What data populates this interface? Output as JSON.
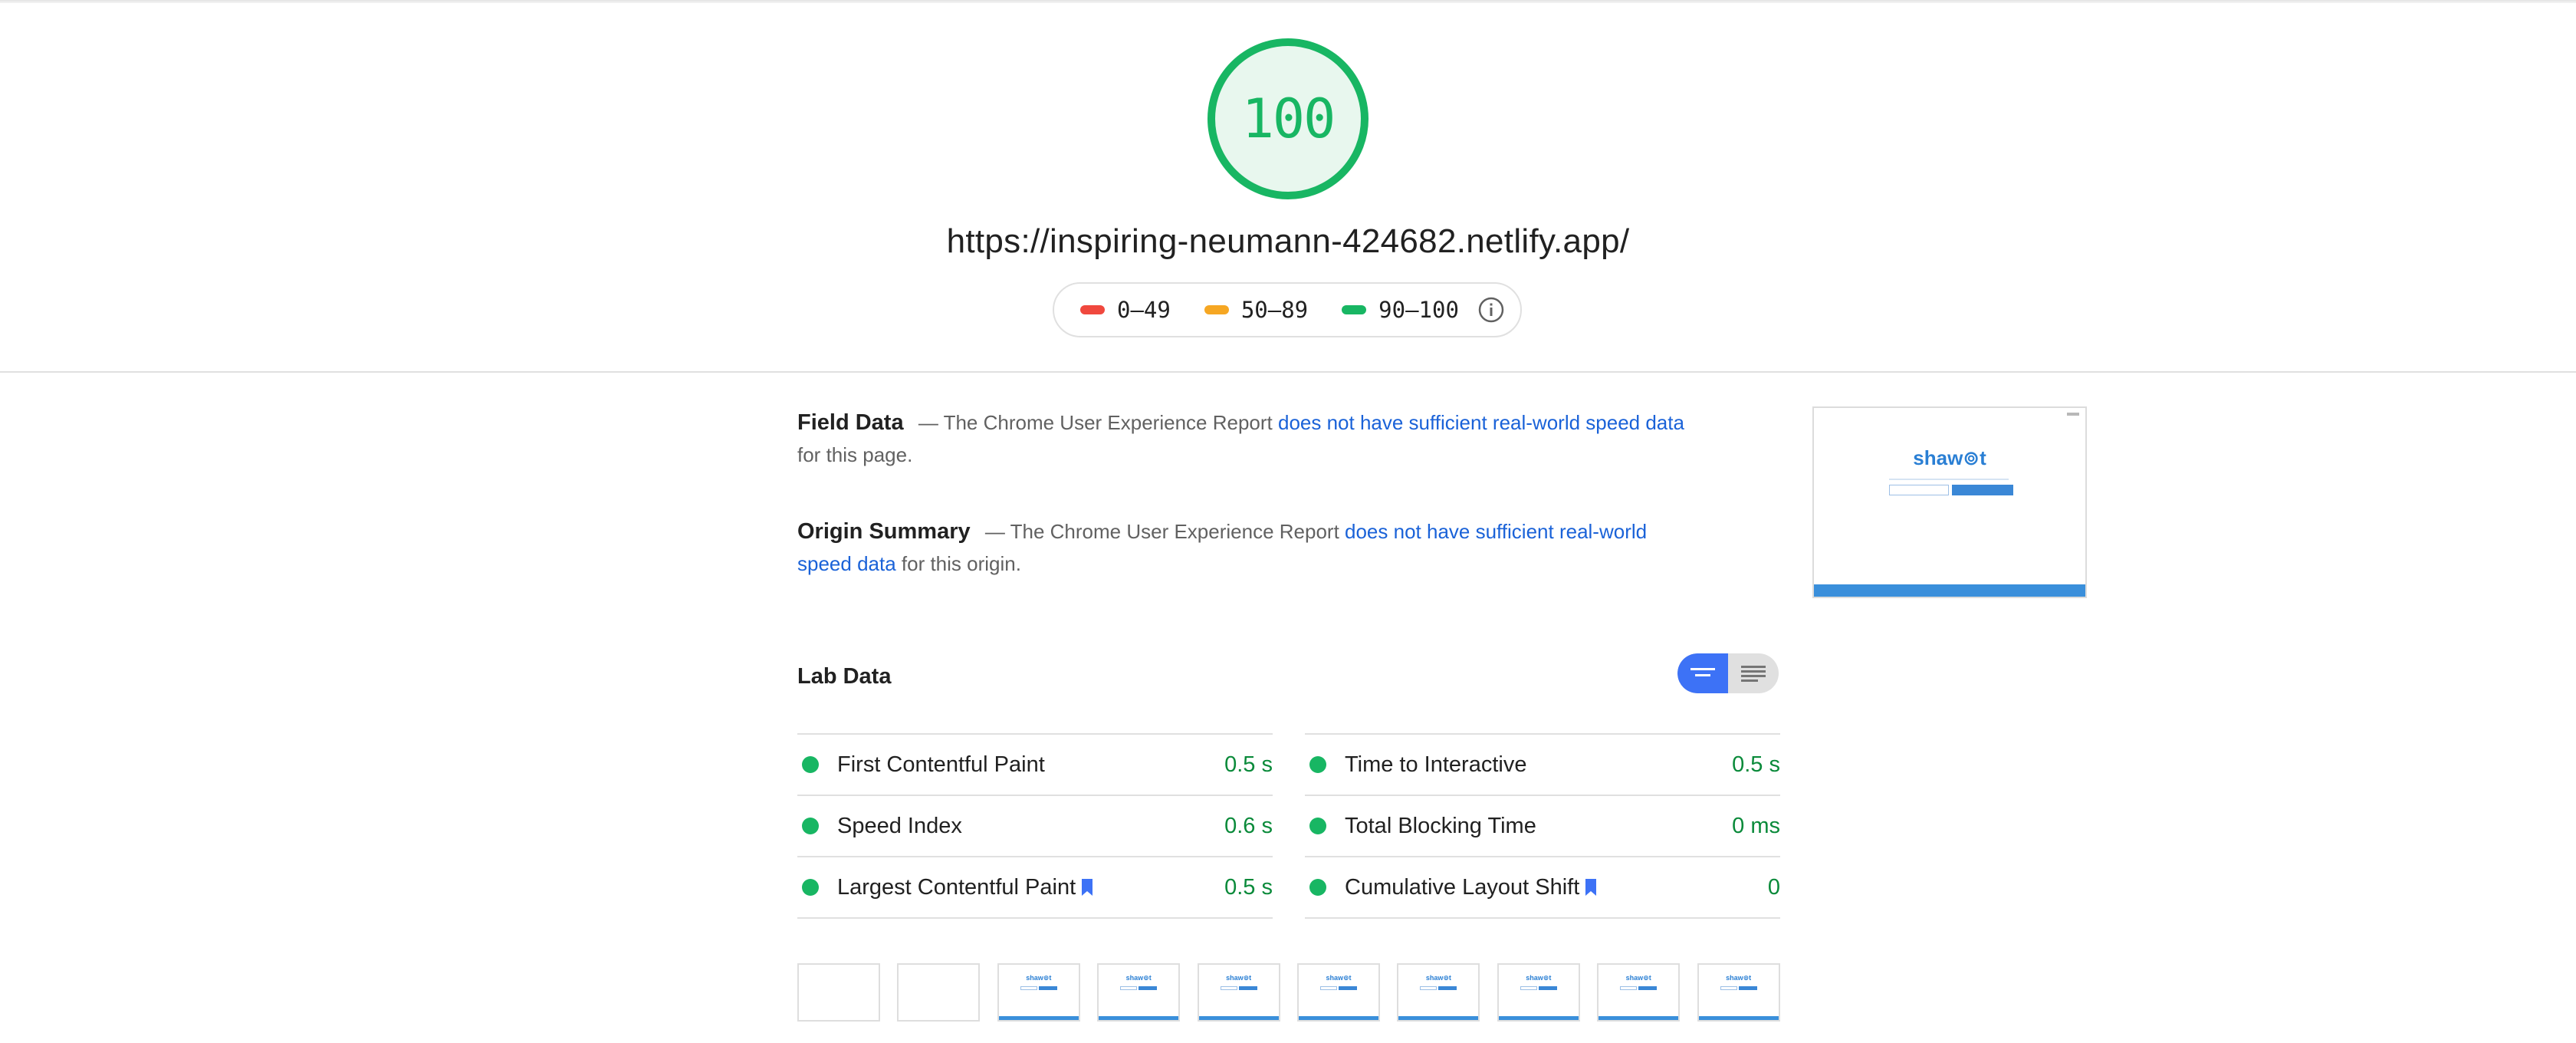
{
  "report": {
    "score": "100",
    "url": "https://inspiring-neumann-424682.netlify.app/",
    "score_fraction": 1.0,
    "score_color": "#18b663"
  },
  "legend": {
    "items": [
      {
        "label": "0–49",
        "color": "#f0483e"
      },
      {
        "label": "50–89",
        "color": "#f6a723"
      },
      {
        "label": "90–100",
        "color": "#18b663"
      }
    ],
    "info_icon": "info-icon"
  },
  "field_data": {
    "title": "Field Data",
    "prefix": "— The Chrome User Experience Report ",
    "link": "does not have sufficient real-world speed data",
    "suffix": " for this page."
  },
  "origin_summary": {
    "title": "Origin Summary",
    "prefix": "— The Chrome User Experience Report ",
    "link": "does not have sufficient real-world speed data",
    "suffix": " for this origin."
  },
  "screenshot": {
    "brand": "shaw⊚t"
  },
  "lab_data": {
    "title": "Lab Data",
    "left": [
      {
        "label": "First Contentful Paint",
        "value": "0.5 s",
        "bookmark": false
      },
      {
        "label": "Speed Index",
        "value": "0.6 s",
        "bookmark": false
      },
      {
        "label": "Largest Contentful Paint",
        "value": "0.5 s",
        "bookmark": true
      }
    ],
    "right": [
      {
        "label": "Time to Interactive",
        "value": "0.5 s",
        "bookmark": false
      },
      {
        "label": "Total Blocking Time",
        "value": "0 ms",
        "bookmark": false
      },
      {
        "label": "Cumulative Layout Shift",
        "value": "0",
        "bookmark": true
      }
    ]
  },
  "filmstrip": {
    "frames": [
      {
        "loaded": false,
        "brand": ""
      },
      {
        "loaded": false,
        "brand": ""
      },
      {
        "loaded": true,
        "brand": "shaw⊚t"
      },
      {
        "loaded": true,
        "brand": "shaw⊚t"
      },
      {
        "loaded": true,
        "brand": "shaw⊚t"
      },
      {
        "loaded": true,
        "brand": "shaw⊚t"
      },
      {
        "loaded": true,
        "brand": "shaw⊚t"
      },
      {
        "loaded": true,
        "brand": "shaw⊚t"
      },
      {
        "loaded": true,
        "brand": "shaw⊚t"
      },
      {
        "loaded": true,
        "brand": "shaw⊚t"
      }
    ]
  }
}
